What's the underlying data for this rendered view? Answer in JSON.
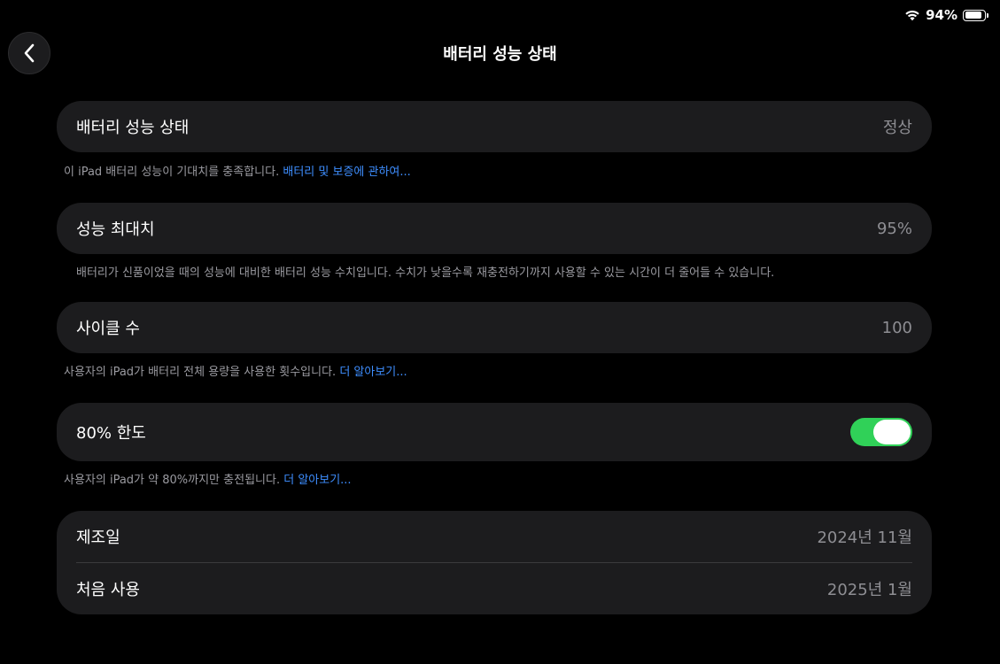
{
  "status_bar": {
    "battery_percent": "94%",
    "battery_level": 0.94
  },
  "header": {
    "title": "배터리 성능 상태"
  },
  "battery_health": {
    "label": "배터리 성능 상태",
    "value": "정상",
    "note": "이 iPad 배터리 성능이 기대치를 충족합니다.",
    "note_link": "배터리 및 보증에 관하여..."
  },
  "max_capacity": {
    "label": "성능 최대치",
    "value": "95%",
    "note": "배터리가 신품이었을 때의 성능에 대비한 배터리 성능 수치입니다. 수치가 낮을수록 재충전하기까지 사용할 수 있는 시간이 더 줄어들 수 있습니다."
  },
  "cycle_count": {
    "label": "사이클 수",
    "value": "100",
    "note": "사용자의 iPad가 배터리 전체 용량을 사용한 횟수입니다.",
    "note_link": "더 알아보기..."
  },
  "limit_80": {
    "label": "80% 한도",
    "enabled": true,
    "note": "사용자의 iPad가 약 80%까지만 충전됩니다.",
    "note_link": "더 알아보기..."
  },
  "dates": {
    "manufacture_label": "제조일",
    "manufacture_value": "2024년 11월",
    "first_use_label": "처음 사용",
    "first_use_value": "2025년 1월"
  },
  "colors": {
    "accent_link": "#3e8eff",
    "toggle_on": "#30d158",
    "card_bg": "#1c1c1e"
  }
}
